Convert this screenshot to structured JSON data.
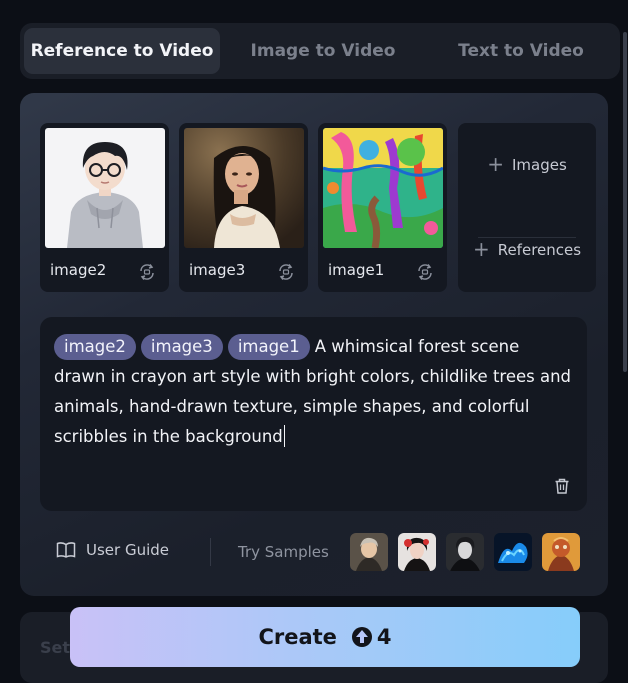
{
  "tabs": [
    {
      "label": "Reference to Video",
      "active": true
    },
    {
      "label": "Image to Video",
      "active": false
    },
    {
      "label": "Text to Video",
      "active": false
    }
  ],
  "references": [
    {
      "name": "image2",
      "thumb": "anime-boy-in-hoodie"
    },
    {
      "name": "image3",
      "thumb": "woman-portrait"
    },
    {
      "name": "image1",
      "thumb": "crayon-forest-drawing"
    }
  ],
  "add_panel": {
    "images_label": "Images",
    "references_label": "References"
  },
  "prompt": {
    "chips": [
      "image2",
      "image3",
      "image1"
    ],
    "text": "A whimsical forest scene drawn in crayon art style with bright colors, childlike trees and animals, hand-drawn texture, simple shapes, and colorful scribbles in the background"
  },
  "footer": {
    "user_guide_label": "User Guide",
    "try_samples_label": "Try Samples",
    "samples": [
      "sample-1",
      "sample-2",
      "sample-3",
      "sample-4",
      "sample-5"
    ]
  },
  "settings": {
    "label": "Set"
  },
  "create": {
    "label": "Create",
    "credits": "4"
  },
  "colors": {
    "background": "#0c0f16",
    "chip": "#5b5e90",
    "create_gradient_start": "#c9c1f7",
    "create_gradient_end": "#86cdfa"
  }
}
